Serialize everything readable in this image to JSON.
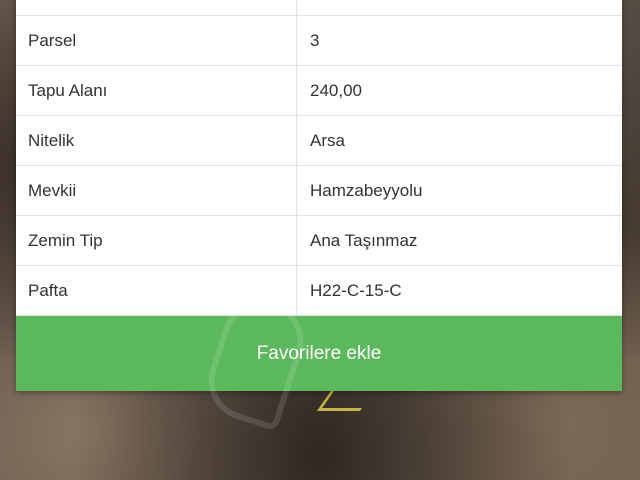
{
  "table": {
    "rows": [
      {
        "label": "Parsel",
        "value": "3"
      },
      {
        "label": "Tapu Alanı",
        "value": "240,00"
      },
      {
        "label": "Nitelik",
        "value": "Arsa"
      },
      {
        "label": "Mevkii",
        "value": "Hamzabeyyolu"
      },
      {
        "label": "Zemin Tip",
        "value": "Ana Taşınmaz"
      },
      {
        "label": "Pafta",
        "value": "H22-C-15-C"
      }
    ]
  },
  "favorite_button": {
    "label": "Favorilere ekle",
    "color": "#5cb85c"
  }
}
